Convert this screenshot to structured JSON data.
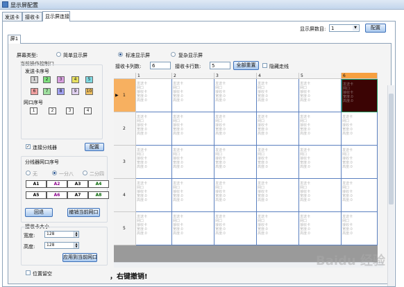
{
  "window": {
    "title": "显示屏配置"
  },
  "main_tabs": [
    {
      "label": "发送卡"
    },
    {
      "label": "接收卡"
    },
    {
      "label": "显示屏连接"
    }
  ],
  "screen_count": {
    "label": "显示屏数目:",
    "value": "1",
    "config_button": "配置"
  },
  "screen_tab": {
    "label": "屏1"
  },
  "screen_type": {
    "label": "屏幕类型:",
    "options": [
      "简单显示屏",
      "标准显示屏",
      "复杂显示屏"
    ],
    "selected": "标准显示屏"
  },
  "drag_area": {
    "title": "当前操作控制口",
    "send_card_label": "发送卡序号",
    "send_cards": [
      "1",
      "2",
      "3",
      "4",
      "5",
      "6",
      "7",
      "8",
      "9",
      "10"
    ],
    "net_port_label": "网口序号",
    "net_ports": [
      "1",
      "2",
      "3",
      "4"
    ]
  },
  "splitter": {
    "checkbox_label": "连接分线器",
    "checked": true,
    "config_button": "配置",
    "port_group_label": "分线器网口序号",
    "modes": [
      "无",
      "一分八",
      "二分四"
    ],
    "selected_mode": "一分八",
    "ports": [
      "A1",
      "A2",
      "A3",
      "A4",
      "A5",
      "A6",
      "A7",
      "A8"
    ],
    "back_button": "回退",
    "cancel_button": "撤销当前网口"
  },
  "receiver_size": {
    "title": "接收卡大小",
    "width_label": "宽度:",
    "width_value": "128",
    "height_label": "高度:",
    "height_value": "128",
    "apply_button": "应用到当前网口"
  },
  "pos_fixed": {
    "label": "位置留空",
    "checked": false
  },
  "grid_config": {
    "cols_label": "接收卡列数:",
    "cols_value": "6",
    "rows_label": "接收卡行数:",
    "rows_value": "5",
    "reset_button": "全部重置",
    "hide_lines_label": "隐藏走线"
  },
  "grid": {
    "columns": [
      "1",
      "2",
      "3",
      "4",
      "5",
      "6"
    ],
    "rows": [
      "1",
      "2",
      "3",
      "4",
      "5"
    ],
    "cell_lines": [
      "发送卡",
      "网口",
      "接收卡",
      "宽度:0",
      "高度:0"
    ]
  },
  "caption": "，右键撤销!",
  "watermark": "Baidu 经验",
  "colors": {
    "current_col_header": "#f7a040",
    "current_row_header": "#f7b060",
    "selected_cell": "#3b0404",
    "cell_border": "#5a7fbf",
    "drag_card_colors": [
      "#d3d3d3",
      "#7fe07f",
      "#d9a0e0",
      "#e7e060",
      "#7fd8e0",
      "#f0a0a0",
      "#a0e0a0",
      "#a0a0f0",
      "#e0d0f0",
      "#f0c060"
    ],
    "port_a_colors": [
      "#000000",
      "#8b008b",
      "#000000",
      "#006400",
      "#000000",
      "#8b008b",
      "#000000",
      "#006400"
    ]
  }
}
